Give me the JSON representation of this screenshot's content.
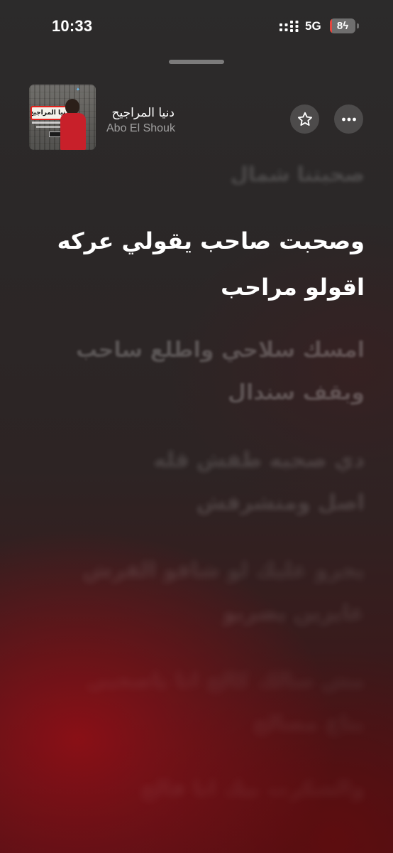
{
  "status_bar": {
    "time": "10:33",
    "network": "5G",
    "battery_percent": 8,
    "battery_label": "8",
    "charging": true,
    "battery_color": "#e5463e"
  },
  "now_playing": {
    "song_title": "دنيا المراجيح",
    "artist": "Abo El Shouk",
    "artwork_title_text": "دنيا المراجيح",
    "favorite_icon": "star-outline-icon",
    "more_icon": "ellipsis-icon"
  },
  "lyrics": [
    {
      "text": "صحبتنا شمال",
      "state": "past"
    },
    {
      "text": "وصحبت صاحب يقولي عركه",
      "state": "current"
    },
    {
      "text": "اقولو مراحب",
      "state": "current"
    },
    {
      "text": "امسك سلاحي واطلع ساحب",
      "state": "upcoming"
    },
    {
      "text": "وبقف سندال",
      "state": "upcoming"
    },
    {
      "text": "دي صحبه طفش قله",
      "state": "upcoming"
    },
    {
      "text": "اصل ومنشرفش",
      "state": "upcoming"
    },
    {
      "text": "يجرو عليك لو شافو الفرش",
      "state": "upcoming"
    },
    {
      "text": "عايزين يضربو",
      "state": "upcoming"
    },
    {
      "text": "مش سالك كالح انا ياصحبي",
      "state": "upcoming"
    },
    {
      "text": "بتاع مصالح",
      "state": "upcoming"
    },
    {
      "text": "والشكرت بيك انا فالح",
      "state": "upcoming"
    }
  ]
}
